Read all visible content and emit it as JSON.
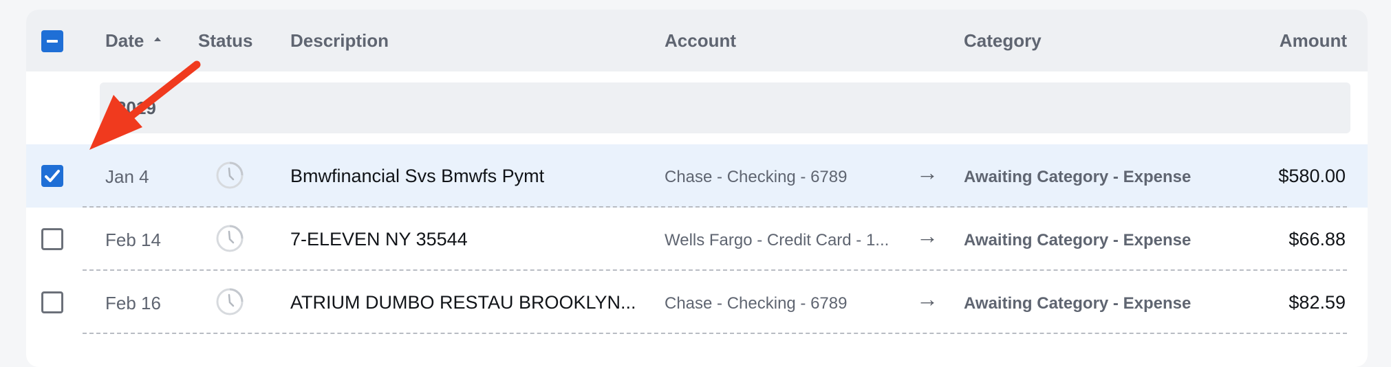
{
  "header": {
    "columns": {
      "date": "Date",
      "status": "Status",
      "description": "Description",
      "account": "Account",
      "category": "Category",
      "amount": "Amount"
    },
    "select_all_state": "indeterminate",
    "sort_indicator": "sort-ascending-icon"
  },
  "group": {
    "label": "2019"
  },
  "rows": [
    {
      "selected": true,
      "date": "Jan 4",
      "status_icon": "clock-icon",
      "description": "Bmwfinancial Svs Bmwfs Pymt",
      "account": "Chase - Checking - 6789",
      "arrow": "→",
      "category": "Awaiting Category - Expense",
      "amount": "$580.00"
    },
    {
      "selected": false,
      "date": "Feb 14",
      "status_icon": "clock-icon",
      "description": "7-ELEVEN NY 35544",
      "account": "Wells Fargo - Credit Card - 1...",
      "arrow": "→",
      "category": "Awaiting Category - Expense",
      "amount": "$66.88"
    },
    {
      "selected": false,
      "date": "Feb 16",
      "status_icon": "clock-icon",
      "description": "ATRIUM DUMBO RESTAU BROOKLYN...",
      "account": "Chase - Checking - 6789",
      "arrow": "→",
      "category": "Awaiting Category - Expense",
      "amount": "$82.59"
    }
  ],
  "colors": {
    "accent": "#1f6fd6",
    "selected_row": "#eaf2fc",
    "annotation_arrow": "#f03a1e"
  }
}
